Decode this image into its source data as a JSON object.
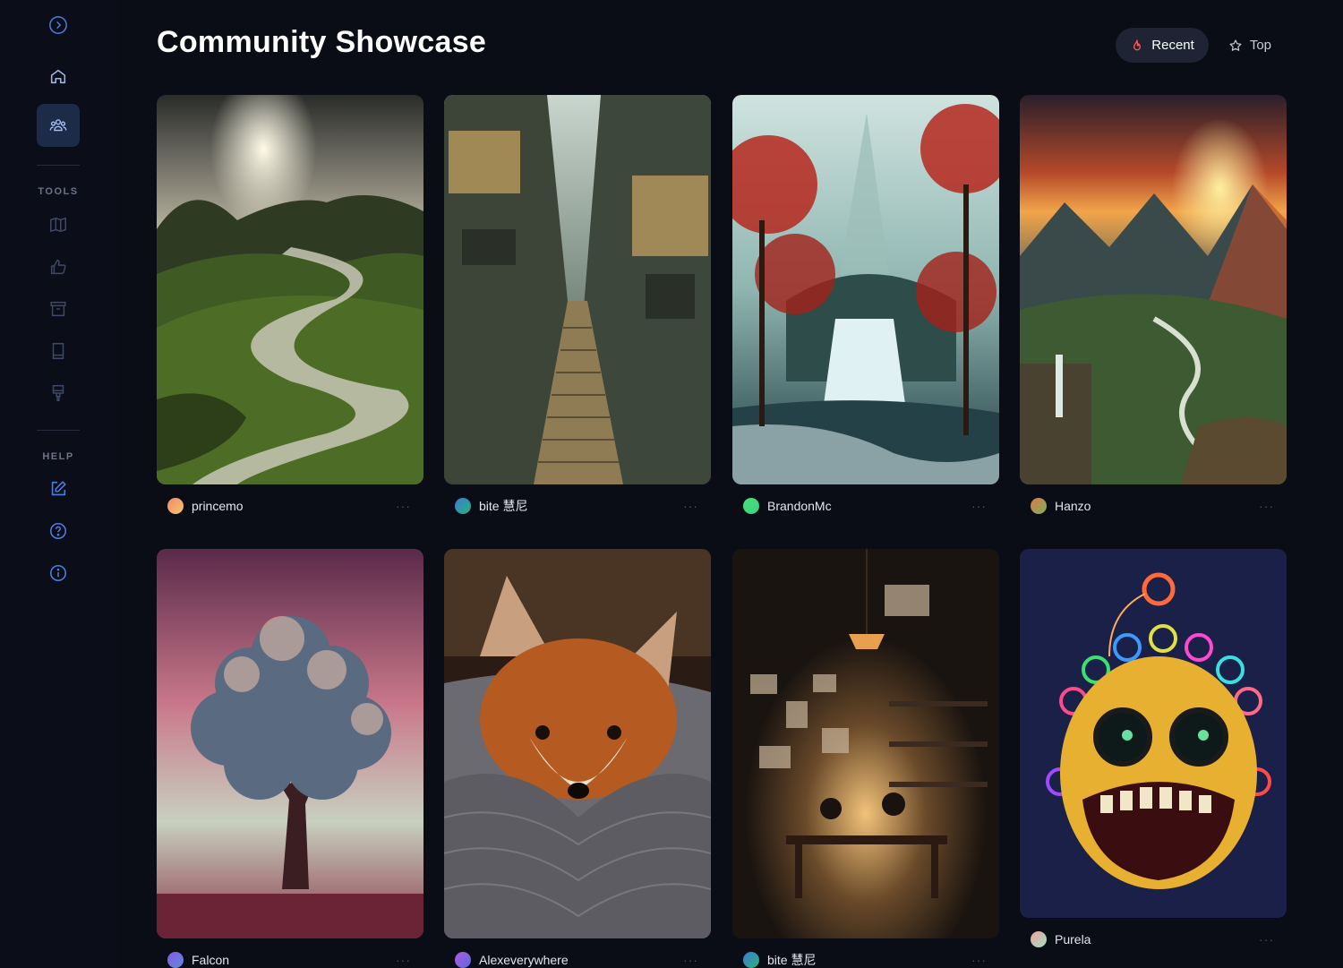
{
  "page": {
    "title": "Community Showcase"
  },
  "sort": {
    "recent_label": "Recent",
    "top_label": "Top"
  },
  "sidebar": {
    "tools_heading": "TOOLS",
    "help_heading": "HELP",
    "icons": {
      "expand": "chevron-right-circle-icon",
      "home": "home-icon",
      "community": "users-icon",
      "tools": [
        "map-icon",
        "thumbs-up-icon",
        "archive-icon",
        "book-icon",
        "paintbrush-icon"
      ],
      "help": [
        "edit-icon",
        "help-circle-icon",
        "info-icon"
      ]
    }
  },
  "gallery": {
    "more_label": "···",
    "cards": [
      {
        "author": "princemo",
        "avatar_from": "#f08a6a",
        "avatar_to": "#f4c56a",
        "image": "river-valley-image"
      },
      {
        "author": "bite 慧尼",
        "avatar_from": "#3a7bd5",
        "avatar_to": "#2bb37a",
        "image": "alley-staircase-image"
      },
      {
        "author": "BrandonMc",
        "avatar_from": "#49e07a",
        "avatar_to": "#3bd07f",
        "image": "waterfall-image"
      },
      {
        "author": "Hanzo",
        "avatar_from": "#e07a4a",
        "avatar_to": "#7ab05a",
        "image": "mountain-sunset-image"
      },
      {
        "author": "Falcon",
        "avatar_from": "#8a5ae0",
        "avatar_to": "#5a8ae0",
        "image": "cloud-tree-image"
      },
      {
        "author": "Alexeverywhere",
        "avatar_from": "#b05ae0",
        "avatar_to": "#5a6ae0",
        "image": "fox-blanket-image"
      },
      {
        "author": "bite 慧尼",
        "avatar_from": "#3a7bd5",
        "avatar_to": "#2bb37a",
        "image": "reading-room-image"
      },
      {
        "author": "Purela",
        "avatar_from": "#f0a0a0",
        "avatar_to": "#a0e0c0",
        "image": "neon-monster-image"
      }
    ]
  },
  "colors": {
    "background": "#0a0c16",
    "active_nav": "#1c2b48",
    "accent_recent": "#ff5a4a"
  }
}
